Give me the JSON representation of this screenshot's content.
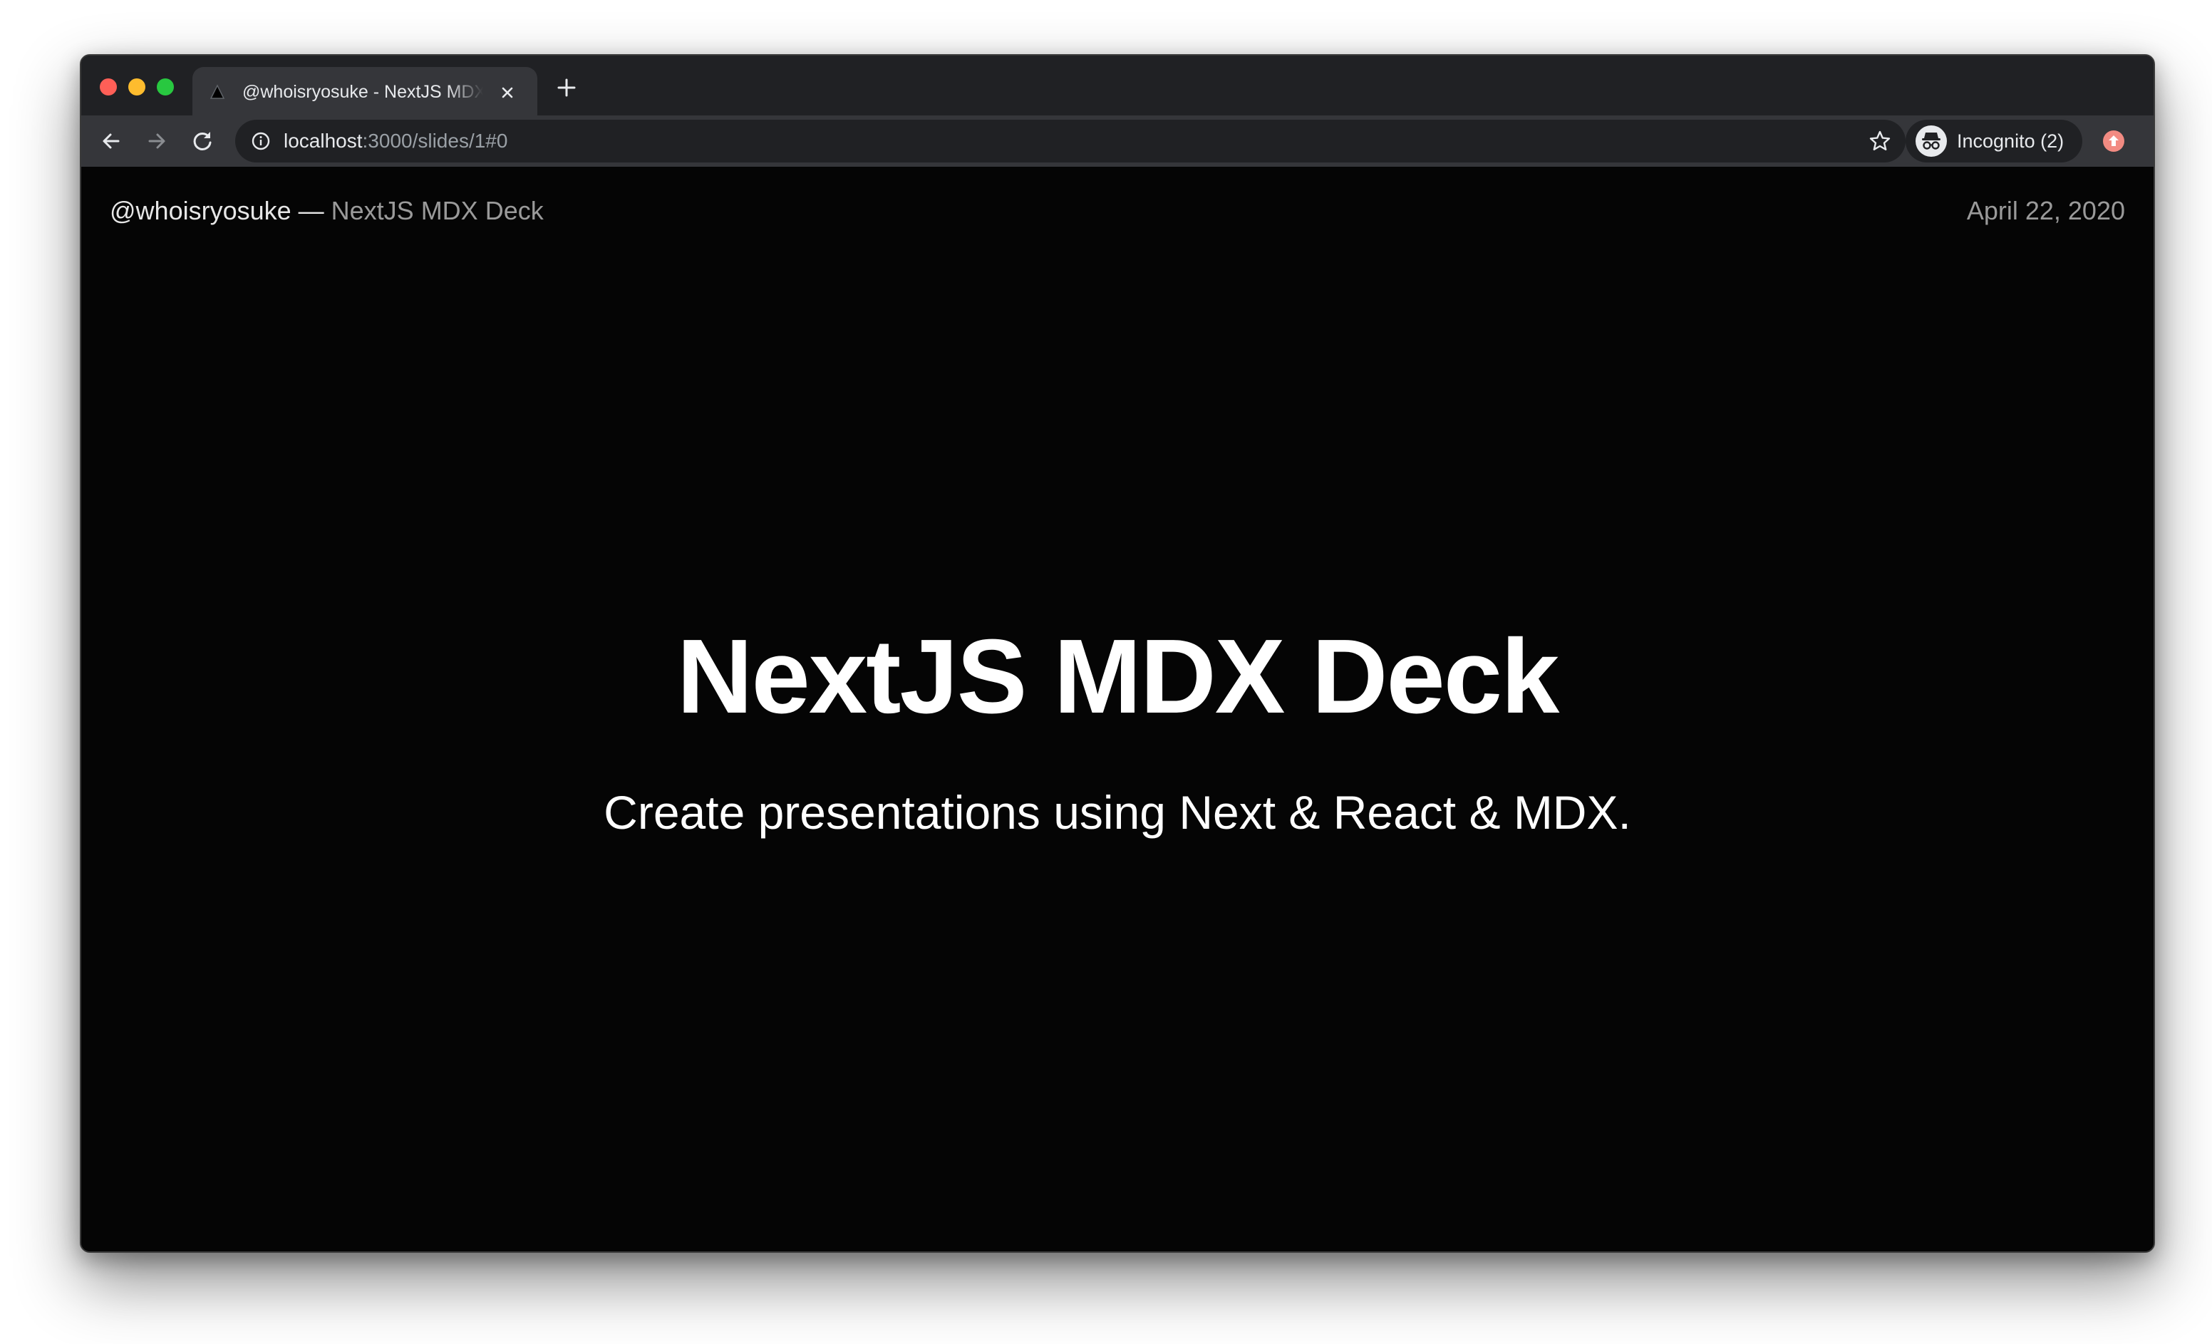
{
  "browser": {
    "tab": {
      "title": "@whoisryosuke - NextJS MDX Deck",
      "favicon": "triangle-icon",
      "close_icon": "close-icon"
    },
    "new_tab_icon": "plus-icon",
    "toolbar": {
      "back_icon": "arrow-left-icon",
      "forward_icon": "arrow-right-icon",
      "reload_icon": "reload-icon"
    },
    "address_bar": {
      "host": "localhost",
      "path": ":3000/slides/1#0",
      "info_icon": "info-icon",
      "bookmark_icon": "star-icon"
    },
    "profile": {
      "label": "Incognito (2)",
      "icon": "incognito-icon"
    },
    "update_icon": "update-icon"
  },
  "slide": {
    "header": {
      "author": "@whoisryosuke",
      "separator": " — ",
      "deck_name": "NextJS MDX Deck",
      "date": "April 22, 2020"
    },
    "title": "NextJS MDX Deck",
    "subtitle": "Create presentations using Next & React & MDX."
  },
  "colors": {
    "page_background": "#050505",
    "tab_strip": "#202124",
    "toolbar": "#35363a",
    "text_primary": "#ffffff",
    "text_muted": "#9a9a9a",
    "update_badge": "#f28b82"
  }
}
